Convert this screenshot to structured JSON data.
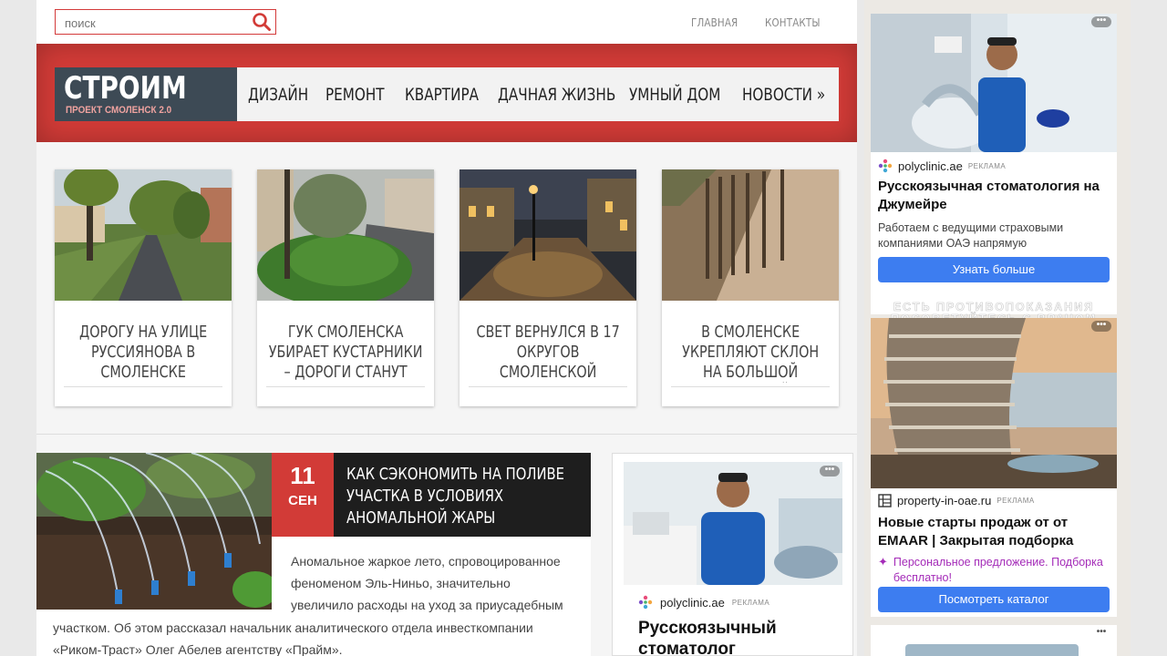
{
  "search": {
    "placeholder": "поиск"
  },
  "topnav": [
    "ГЛАВНАЯ",
    "КОНТАКТЫ"
  ],
  "logo": {
    "title": "СТРОИМ",
    "subtitle": "ПРОЕКТ СМОЛЕНСК 2.0"
  },
  "mainnav": [
    "ДИЗАЙН",
    "РЕМОНТ",
    "КВАРТИРА",
    "ДАЧНАЯ ЖИЗНЬ",
    "УМНЫЙ ДОМ",
    "НОВОСТИ »"
  ],
  "cards": [
    {
      "title": "ДОРОГУ НА УЛИЦЕ РУССИЯНОВА В СМОЛЕНСКЕ"
    },
    {
      "title": "ГУК СМОЛЕНСКА УБИРАЕТ КУСТАРНИКИ – ДОРОГИ СТАНУТ"
    },
    {
      "title": "СВЕТ ВЕРНУЛСЯ В 17 ОКРУГОВ СМОЛЕНСКОЙ"
    },
    {
      "title": "В СМОЛЕНСКЕ УКРЕПЛЯЮТ СКЛОН НА БОЛЬШОЙ СОВЕТСКОЙ:"
    }
  ],
  "article": {
    "day": "11",
    "month": "СЕН",
    "title": "КАК СЭКОНОМИТЬ НА ПОЛИВЕ УЧАСТКА В УСЛОВИЯХ АНОМАЛЬНОЙ ЖАРЫ",
    "text_part1": "Аномальное жаркое лето, спровоцированное феноменом Эль-Ниньо, значительно увеличило расходы на уход за приусадебным",
    "text_part2": "участком. Об этом рассказал начальник аналитического отдела инвесткомпании «Риком-Траст» Олег Абелев агентству «Прайм»."
  },
  "inline_ad": {
    "source": "polyclinic.ae",
    "tag": "РЕКЛАМА",
    "headline": "Русскоязычный стоматолог"
  },
  "side_ads": [
    {
      "source": "polyclinic.ae",
      "tag": "РЕКЛАМА",
      "headline": "Русскоязычная стоматология на Джумейре",
      "description": "Работаем с ведущими страховыми компаниями ОАЭ напрямую",
      "button": "Узнать больше",
      "warning": "ЕСТЬ ПРОТИВОПОКАЗАНИЯ ПОСОВЕТУЙТЕСЬ С ВРАЧОМ"
    },
    {
      "source": "property-in-oae.ru",
      "tag": "РЕКЛАМА",
      "headline": "Новые старты продаж от от EMAAR | Закрытая подборка",
      "description": "Персональное предложение. Подборка бесплатно!",
      "button": "Посмотреть каталог"
    }
  ],
  "ad_menu": "•••",
  "colors": {
    "brand_red": "#d23b37",
    "logo_bg": "#3d4a55",
    "ad_button": "#3d7df0",
    "promo_text": "#a42bb8"
  }
}
